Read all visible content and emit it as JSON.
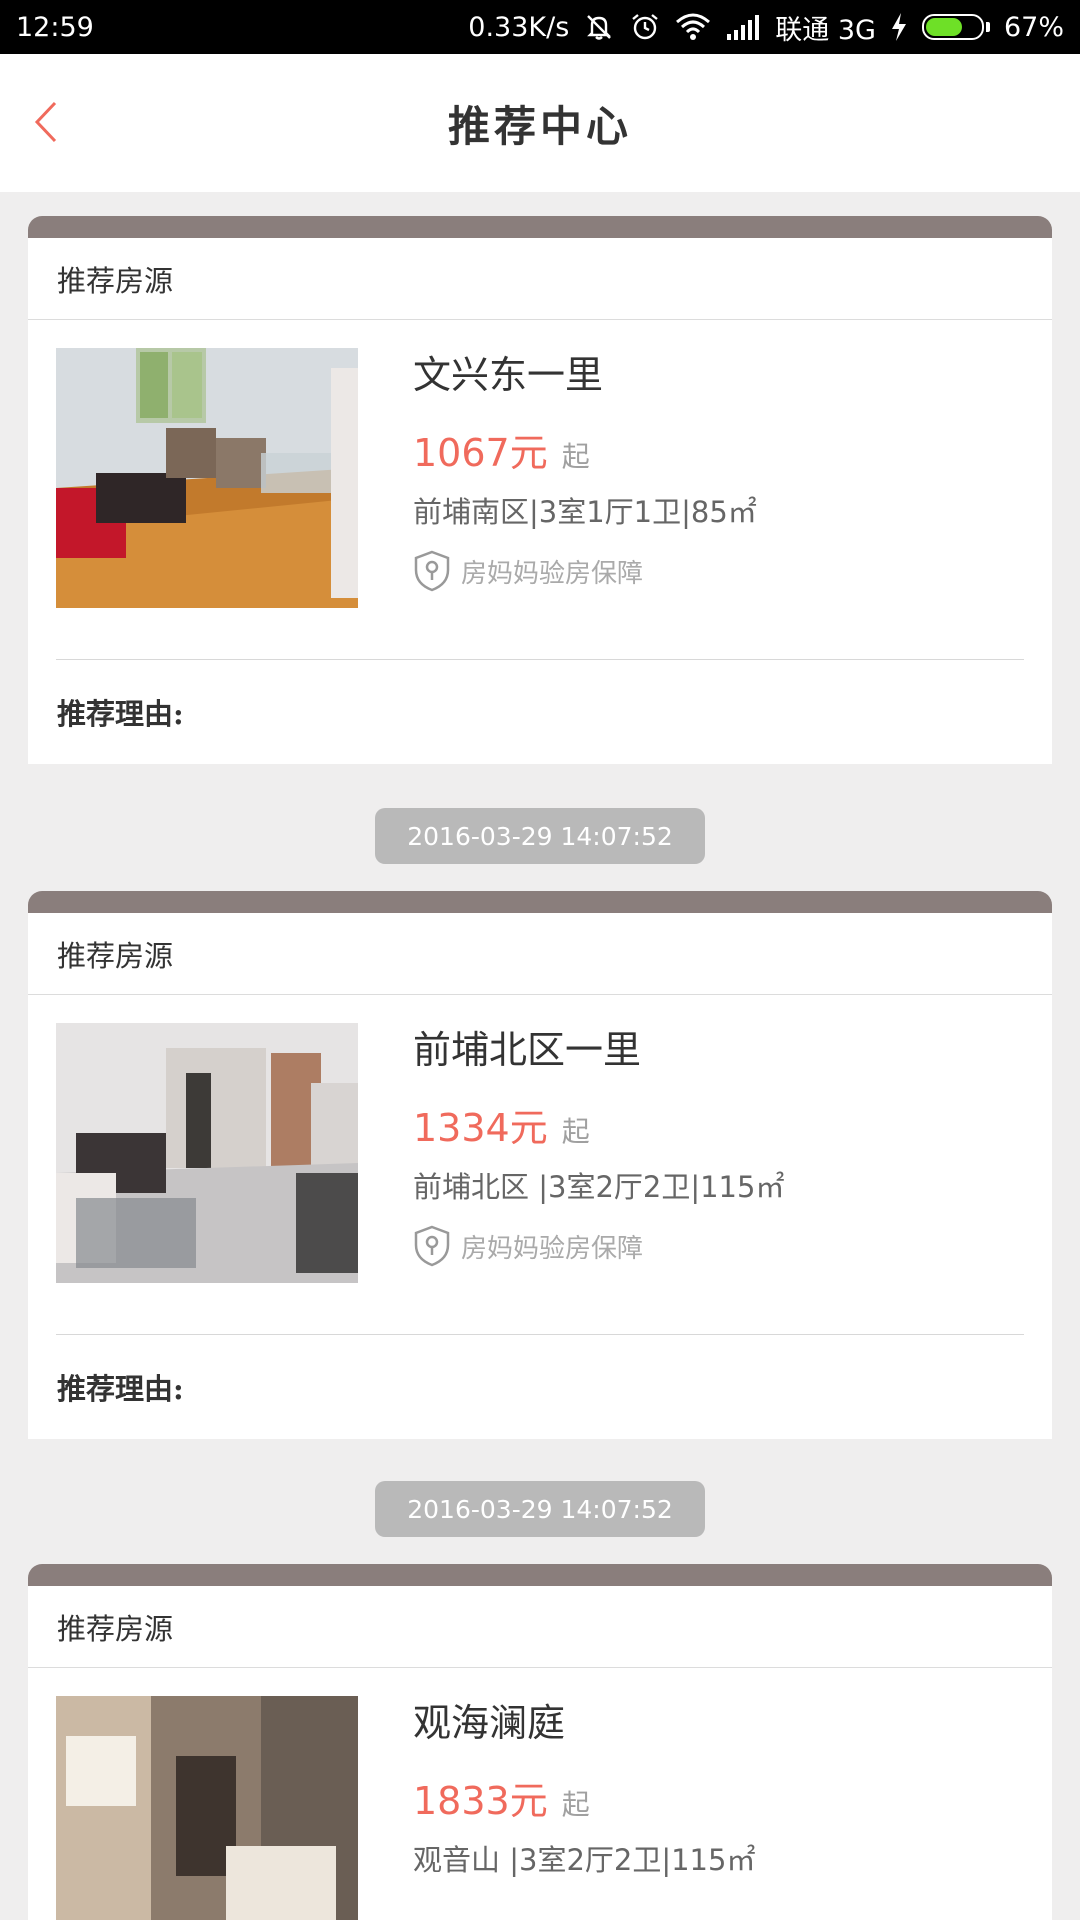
{
  "status_bar": {
    "time": "12:59",
    "net_speed": "0.33K/s",
    "carrier": "联通 3G",
    "battery_percent": "67%",
    "battery_level": 0.67,
    "icons": [
      "mute-icon",
      "alarm-icon",
      "wifi-icon",
      "signal-icon",
      "charging-icon",
      "battery-icon"
    ]
  },
  "header": {
    "title": "推荐中心",
    "back_icon": "chevron-left-icon",
    "accent_color": "#f06a5c"
  },
  "listings": [
    {
      "section_label": "推荐房源",
      "name": "文兴东一里",
      "price": "1067元",
      "price_suffix": "起",
      "detail": "前埔南区|3室1厅1卫|85㎡",
      "guarantee": "房妈妈验房保障",
      "reason_label": "推荐理由:"
    },
    {
      "section_label": "推荐房源",
      "name": "前埔北区一里",
      "price": "1334元",
      "price_suffix": "起",
      "detail": "前埔北区 |3室2厅2卫|115㎡",
      "guarantee": "房妈妈验房保障",
      "reason_label": "推荐理由:"
    },
    {
      "section_label": "推荐房源",
      "name": "观海澜庭",
      "price": "1833元",
      "price_suffix": "起",
      "detail": "观音山 |3室2厅2卫|115㎡"
    }
  ],
  "timestamps": [
    "2016-03-29 14:07:52",
    "2016-03-29 14:07:52"
  ],
  "colors": {
    "card_band": "#8a7e7c",
    "price": "#f06a5c",
    "background": "#efeeee",
    "timestamp_bg": "#b9b9b9"
  }
}
